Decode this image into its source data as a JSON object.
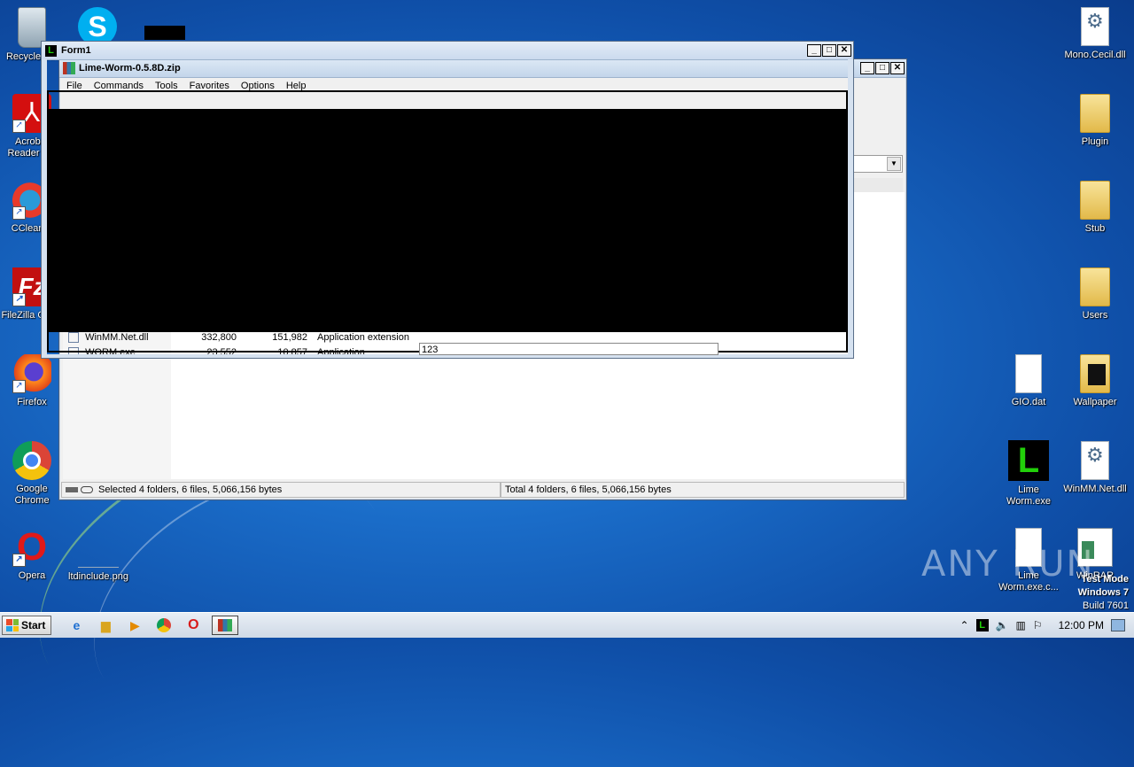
{
  "desktop": {
    "left_icons": [
      {
        "label": "Recycle Bin",
        "icon": "recycle-bin-icon"
      },
      {
        "label": "Acrobat Reader DC",
        "icon": "acrobat-icon"
      },
      {
        "label": "CCleaner",
        "icon": "ccleaner-icon"
      },
      {
        "label": "FileZilla Client",
        "icon": "filezilla-icon"
      },
      {
        "label": "Firefox",
        "icon": "firefox-icon"
      },
      {
        "label": "Google Chrome",
        "icon": "chrome-icon"
      },
      {
        "label": "Opera",
        "icon": "opera-icon"
      },
      {
        "label": "ltdinclude.png",
        "icon": "image-file-icon"
      },
      {
        "label": "Skype",
        "icon": "skype-icon"
      }
    ],
    "right_icons": [
      {
        "label": "Mono.Cecil.dll",
        "icon": "dll-gear-icon"
      },
      {
        "label": "Plugin",
        "icon": "folder-icon"
      },
      {
        "label": "Stub",
        "icon": "folder-icon"
      },
      {
        "label": "Users",
        "icon": "folder-icon"
      },
      {
        "label": "GIO.dat",
        "icon": "file-icon"
      },
      {
        "label": "Wallpaper",
        "icon": "folder-icon"
      },
      {
        "label": "Lime Worm.exe",
        "icon": "lime-icon"
      },
      {
        "label": "WinMM.Net.dll",
        "icon": "dll-gear-icon"
      },
      {
        "label": "Lime Worm.exe.c...",
        "icon": "file-icon"
      },
      {
        "label": "WinRAR",
        "icon": "winrar-icon"
      }
    ]
  },
  "form1": {
    "title": "Form1",
    "input_value": "123"
  },
  "winrar": {
    "title": "Lime-Worm-0.5.8D.zip",
    "menu": [
      "File",
      "Commands",
      "Tools",
      "Favorites",
      "Options",
      "Help"
    ],
    "files": [
      {
        "name": "WinMM.Net.dll",
        "size": "332,800",
        "packed": "151,982",
        "type": "Application extension"
      },
      {
        "name": "WORM.exe",
        "size": "23,552",
        "packed": "10,857",
        "type": "Application"
      }
    ],
    "status_left": "Selected 4 folders, 6 files, 5,066,156 bytes",
    "status_right": "Total 4 folders, 6 files, 5,066,156 bytes"
  },
  "watermark": "ANY RUN",
  "test_mode": {
    "line1": "Test Mode",
    "line2": "Windows 7",
    "line3": "Build 7601"
  },
  "taskbar": {
    "start_label": "Start",
    "clock": "12:00 PM"
  }
}
